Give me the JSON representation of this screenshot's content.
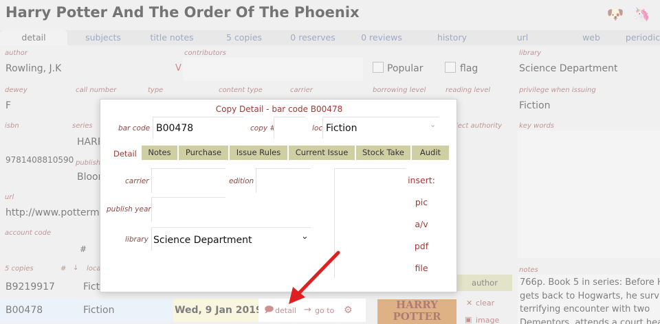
{
  "header": {
    "title": "Harry Potter And The Order Of The Phoenix",
    "icons": [
      "dog-cartoon-icon",
      "unicorn-icon"
    ]
  },
  "tabs": [
    {
      "label": "detail",
      "active": true
    },
    {
      "label": "subjects"
    },
    {
      "label": "title notes"
    },
    {
      "label": "5 copies"
    },
    {
      "label": "0 reserves"
    },
    {
      "label": "0 reviews"
    },
    {
      "label": "history"
    },
    {
      "label": "url"
    },
    {
      "label": "web"
    },
    {
      "label": "periodic"
    }
  ],
  "fields": {
    "author_label": "author",
    "author": "Rowling, J.K",
    "author_flag": "V",
    "contributors_label": "contributors",
    "popular_label": "Popular",
    "flag_label": "flag",
    "library_label": "library",
    "library": "Science Department",
    "dewey_label": "dewey",
    "dewey": "F",
    "call_number_label": "call number",
    "type_label": "type",
    "content_type_label": "content type",
    "carrier_label": "carrier",
    "borrowing_level_label": "borrowing level",
    "reading_level_label": "reading level",
    "privilege_label": "privilege when issuing",
    "privilege": "Fiction",
    "isbn_label": "isbn",
    "isbn": "9781408810590",
    "series_label": "series",
    "series": "HARR",
    "publisher_label": "publishe",
    "publisher": "Bloor",
    "select_authority_label": "lect authority",
    "keywords_label": "key words",
    "url_label": "url",
    "url": "http://www.pottermo",
    "account_code_label": "account code",
    "account_hash": "#",
    "notes_label": "notes",
    "notes": "766p. Book 5 in series: Before H gets back to Hogwarts, he surviv terrifying encounter with two Dementors, attends a court hea"
  },
  "copies": {
    "header_label": "5 copies",
    "hash": "#",
    "arrow": "↓",
    "loc_label": "locat",
    "rows": [
      {
        "barcode": "B9219917",
        "loc": "Fictio"
      },
      {
        "barcode": "B00478",
        "loc": "Fiction",
        "date": "Wed, 9 Jan 2019",
        "detail": "detail",
        "goto": "go to"
      }
    ]
  },
  "right_panel": {
    "author_btn": "author",
    "clear": "clear",
    "image": "image",
    "cover_text": "HARRY POTTER"
  },
  "modal": {
    "title": "Copy Detail - bar code B00478",
    "barcode_label": "bar code",
    "barcode": "B00478",
    "copy_label": "copy #",
    "copy": "",
    "loc_label": "loc",
    "loc": "Fiction",
    "tabs": [
      "Detail",
      "Notes",
      "Purchase",
      "Issue Rules",
      "Current Issue",
      "Stock Take",
      "Audit"
    ],
    "carrier_label": "carrier",
    "carrier": "",
    "edition_label": "edition",
    "edition": "",
    "publish_year_label": "publish year",
    "publish_year": "",
    "library_label": "library",
    "library": "Science Department",
    "insert_label": "insert:",
    "links": [
      "pic",
      "a/v",
      "pdf",
      "file"
    ]
  },
  "colors": {
    "accent_red": "#a03a36",
    "tab_olive": "#cfcfa4",
    "date_highlight": "#f4f0c8",
    "row_selected": "#dfe8f4"
  }
}
